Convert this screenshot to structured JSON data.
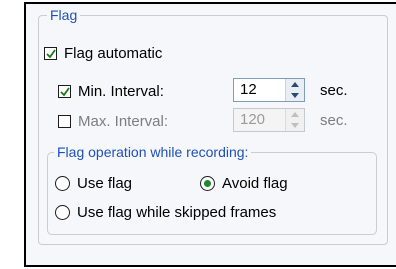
{
  "flag_group": {
    "title": "Flag",
    "flag_automatic": {
      "label": "Flag automatic",
      "checked": true
    },
    "min_interval": {
      "label": "Min. Interval:",
      "checked": true,
      "value": "12",
      "unit": "sec.",
      "enabled": true
    },
    "max_interval": {
      "label": "Max. Interval:",
      "checked": false,
      "value": "120",
      "unit": "sec.",
      "enabled": false
    },
    "operation": {
      "title": "Flag operation while recording:",
      "use_flag": {
        "label": "Use flag",
        "selected": false
      },
      "avoid_flag": {
        "label": "Avoid flag",
        "selected": true
      },
      "use_flag_skipped": {
        "label": "Use flag while skipped frames",
        "selected": false
      }
    }
  },
  "colors": {
    "legend": "#1f4fb8",
    "radio_dot": "#1b8a2e",
    "disabled_text": "#7d7d7d"
  }
}
